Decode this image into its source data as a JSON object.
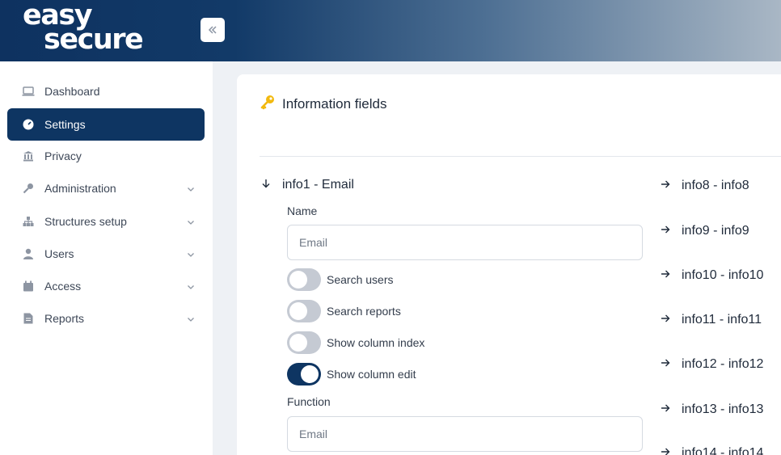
{
  "brand": {
    "line1": "easy",
    "line2": "secure"
  },
  "sidebar": {
    "items": [
      {
        "label": "Dashboard",
        "icon": "laptop-icon"
      },
      {
        "label": "Settings",
        "icon": "gauge-icon",
        "active": true
      },
      {
        "label": "Privacy",
        "icon": "building-icon"
      },
      {
        "label": "Administration",
        "icon": "key-icon",
        "expandable": true
      },
      {
        "label": "Structures setup",
        "icon": "sitemap-icon",
        "expandable": true
      },
      {
        "label": "Users",
        "icon": "user-icon",
        "expandable": true
      },
      {
        "label": "Access",
        "icon": "calendar-icon",
        "expandable": true
      },
      {
        "label": "Reports",
        "icon": "file-icon",
        "expandable": true
      }
    ]
  },
  "panel": {
    "title": "Information fields",
    "expanded": {
      "label": "info1 - Email",
      "name_label": "Name",
      "name_placeholder": "Email",
      "toggles": [
        {
          "label": "Search users",
          "on": false
        },
        {
          "label": "Search reports",
          "on": false
        },
        {
          "label": "Show column index",
          "on": false
        },
        {
          "label": "Show column edit",
          "on": true
        }
      ],
      "function_label": "Function",
      "function_placeholder": "Email"
    },
    "right_items": [
      "info8 - info8",
      "info9 - info9",
      "info10 - info10",
      "info11 - info11",
      "info12 - info12",
      "info13 - info13",
      "info14 - info14"
    ]
  },
  "colors": {
    "accent": "#0e3562",
    "key_icon": "#f2b90f"
  }
}
